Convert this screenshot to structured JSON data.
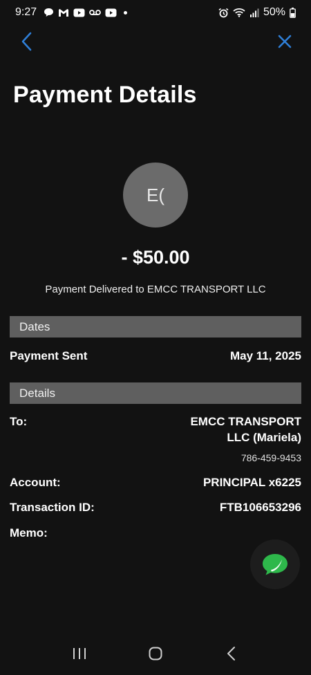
{
  "status_bar": {
    "time": "9:27",
    "battery": "50%",
    "icons_left": [
      "chat-icon",
      "gmail-icon",
      "youtube-icon",
      "voicemail-icon",
      "youtube-icon",
      "notification-dot"
    ],
    "icons_right": [
      "alarm-icon",
      "wifi-icon",
      "signal-icon",
      "battery-icon"
    ]
  },
  "nav": {
    "back_icon": "chevron-left-icon",
    "close_icon": "close-icon",
    "accent_color": "#2f7fd8"
  },
  "page": {
    "title": "Payment Details"
  },
  "payee": {
    "avatar_initials": "E(",
    "amount": "- $50.00",
    "status_text": "Payment Delivered to EMCC TRANSPORT LLC"
  },
  "dates": {
    "header": "Dates",
    "payment_sent_label": "Payment Sent",
    "payment_sent_value": "May 11, 2025"
  },
  "details": {
    "header": "Details",
    "to_label": "To:",
    "to_value_line1": "EMCC TRANSPORT",
    "to_value_line2": "LLC (Mariela)",
    "to_phone": "786-459-9453",
    "account_label": "Account:",
    "account_value": "PRINCIPAL x6225",
    "transaction_label": "Transaction ID:",
    "transaction_value": "FTB106653296",
    "memo_label": "Memo:",
    "memo_value": ""
  },
  "chat": {
    "icon": "chat-bubble-icon",
    "color": "#2eb84b"
  },
  "system_nav": {
    "recent_icon": "recent-apps-icon",
    "home_icon": "home-icon",
    "back_icon": "back-icon"
  }
}
